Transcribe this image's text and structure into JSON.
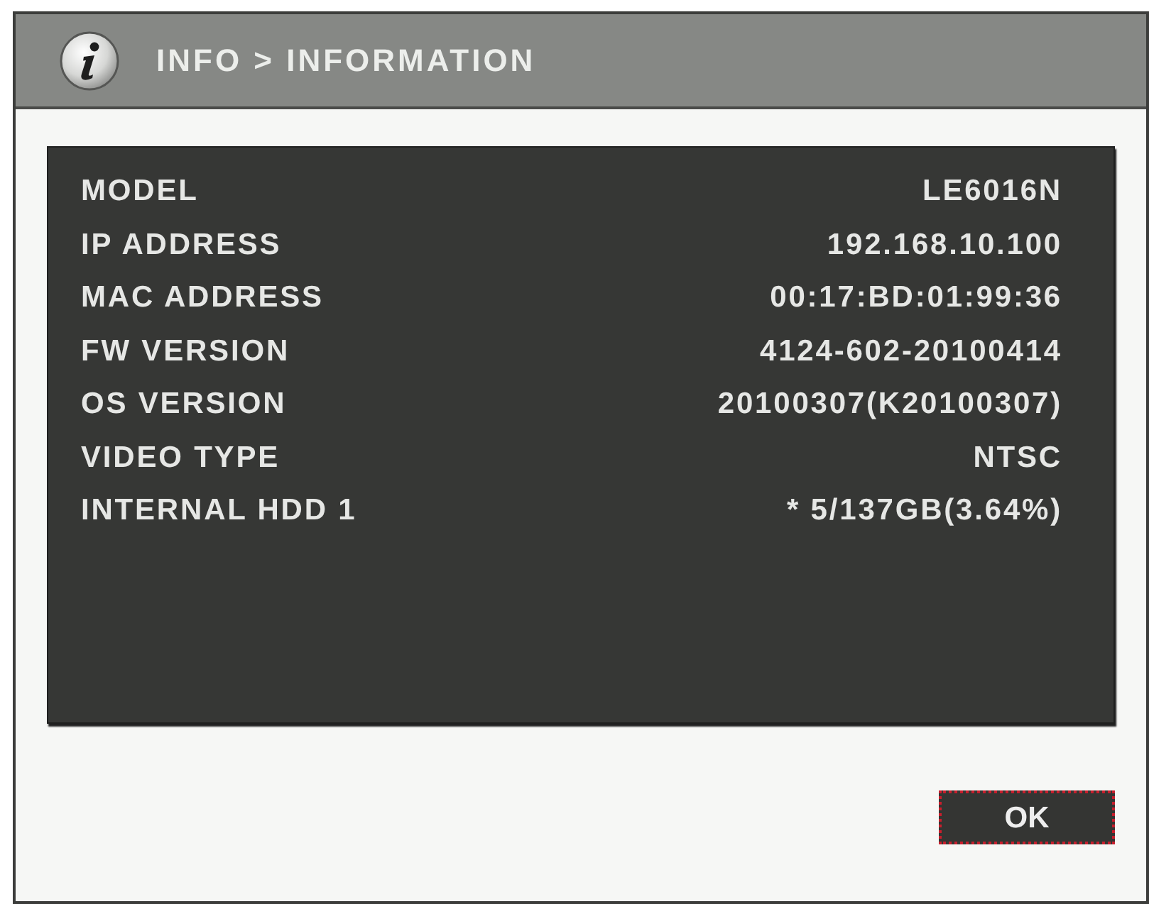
{
  "window": {
    "title": "INFO > INFORMATION"
  },
  "info_rows": [
    {
      "label": "MODEL",
      "value": "LE6016N"
    },
    {
      "label": "IP ADDRESS",
      "value": "192.168.10.100"
    },
    {
      "label": "MAC ADDRESS",
      "value": "00:17:BD:01:99:36"
    },
    {
      "label": "FW VERSION",
      "value": "4124-602-20100414"
    },
    {
      "label": "OS VERSION",
      "value": "20100307(K20100307)"
    },
    {
      "label": "VIDEO TYPE",
      "value": "NTSC"
    },
    {
      "label": "INTERNAL HDD 1",
      "value": "* 5/137GB(3.64%)"
    }
  ],
  "buttons": [
    {
      "label": "OK",
      "selected": true
    }
  ]
}
